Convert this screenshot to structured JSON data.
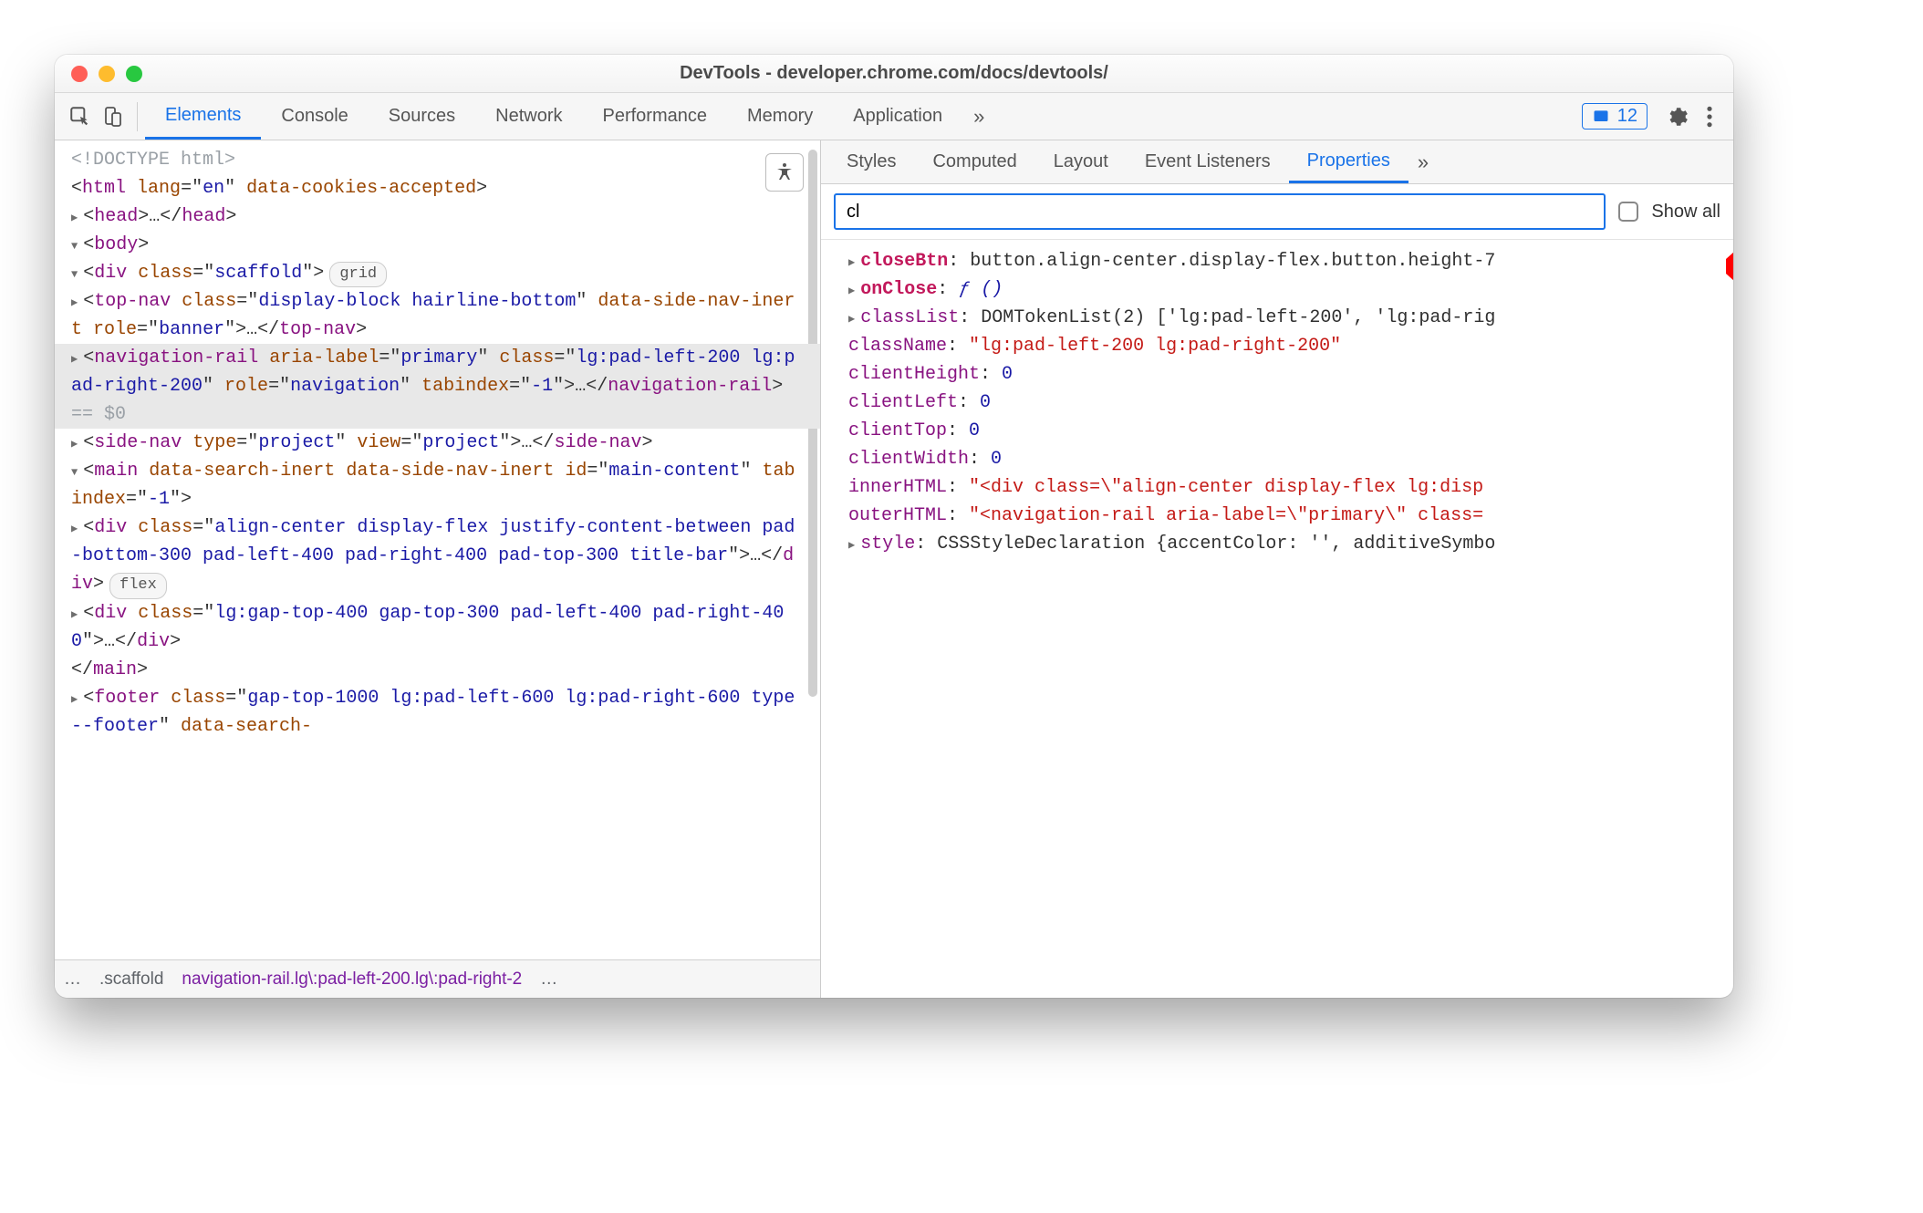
{
  "window": {
    "title": "DevTools - developer.chrome.com/docs/devtools/"
  },
  "mainTabs": {
    "items": [
      "Elements",
      "Console",
      "Sources",
      "Network",
      "Performance",
      "Memory",
      "Application"
    ],
    "activeIndex": 0,
    "overflow": "»",
    "issuesCount": "12"
  },
  "tree": {
    "doctype": "<!DOCTYPE html>",
    "html_open": {
      "tag": "html",
      "attrs": "lang=\"en\" data-cookies-accepted"
    },
    "head": {
      "open": "<head>",
      "ell": "…",
      "close": "</head>"
    },
    "body_open": "<body>",
    "div_scaffold": {
      "tag": "div",
      "class": "scaffold",
      "badge": "grid"
    },
    "topnav": {
      "tag": "top-nav",
      "attrs": "class=\"display-block hairline-bottom\" data-side-nav-inert role=\"banner\"",
      "ell": "…"
    },
    "navrail": {
      "tag": "navigation-rail",
      "attrs": "aria-label=\"primary\" class=\"lg:pad-left-200 lg:pad-right-200\" role=\"navigation\" tabindex=\"-1\"",
      "ell": "…",
      "suffix": " == $0"
    },
    "sidenav": {
      "tag": "side-nav",
      "attrs": "type=\"project\" view=\"project\"",
      "ell": "…"
    },
    "main": {
      "tag": "main",
      "attrs": "data-search-inert data-side-nav-inert id=\"main-content\" tabindex=\"-1\""
    },
    "div_title": {
      "tag": "div",
      "class": "align-center display-flex justify-content-between pad-bottom-300 pad-left-400 pad-right-400 pad-top-300 title-bar",
      "ell": "…",
      "badge": "flex"
    },
    "div_gap": {
      "tag": "div",
      "class": "lg:gap-top-400 gap-top-300 pad-left-400 pad-right-400",
      "ell": "…"
    },
    "main_close": "</main>",
    "footer": {
      "tag": "footer",
      "attrs": "class=\"gap-top-1000 lg:pad-left-600 lg:pad-right-600 type--footer\" data-search-"
    }
  },
  "crumbs": {
    "ell": "…",
    "a": ".scaffold",
    "b": "navigation-rail.lg\\:pad-left-200.lg\\:pad-right-2",
    "ell2": "…"
  },
  "subTabs": {
    "items": [
      "Styles",
      "Computed",
      "Layout",
      "Event Listeners",
      "Properties"
    ],
    "activeIndex": 4,
    "overflow": "»"
  },
  "filter": {
    "value": "cl",
    "showAll": "Show all"
  },
  "props": [
    {
      "k": "closeBtn",
      "kbold": true,
      "expandable": true,
      "v": "button.align-center.display-flex.button.height-7",
      "vclass": "pv-dark"
    },
    {
      "k": "onClose",
      "kbold": true,
      "expandable": true,
      "v": "ƒ ()",
      "vclass": "pv-ital"
    },
    {
      "k": "classList",
      "expandable": true,
      "v": "DOMTokenList(2) ['lg:pad-left-200', 'lg:pad-rig",
      "vclass": "pv-dark"
    },
    {
      "k": "className",
      "v": "\"lg:pad-left-200 lg:pad-right-200\"",
      "vclass": "pv-red"
    },
    {
      "k": "clientHeight",
      "v": "0",
      "vclass": "pv-blue"
    },
    {
      "k": "clientLeft",
      "v": "0",
      "vclass": "pv-blue"
    },
    {
      "k": "clientTop",
      "v": "0",
      "vclass": "pv-blue"
    },
    {
      "k": "clientWidth",
      "v": "0",
      "vclass": "pv-blue"
    },
    {
      "k": "innerHTML",
      "v": "\"<div class=\\\"align-center display-flex lg:disp",
      "vclass": "pv-red"
    },
    {
      "k": "outerHTML",
      "v": "\"<navigation-rail aria-label=\\\"primary\\\" class=",
      "vclass": "pv-red"
    },
    {
      "k": "style",
      "expandable": true,
      "v": "CSSStyleDeclaration {accentColor: '', additiveSymbo",
      "vclass": "pv-dark"
    }
  ]
}
